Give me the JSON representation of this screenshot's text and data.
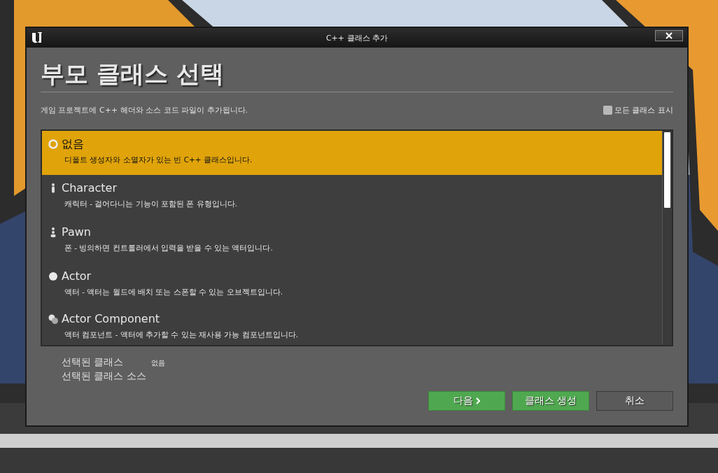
{
  "window": {
    "title": "C++ 클래스 추가"
  },
  "heading": "부모 클래스 선택",
  "description": "게임 프로젝트에 C++ 헤더와 소스 코드 파일이 추가됩니다.",
  "show_all_classes": {
    "label": "모든 클래스 표시",
    "checked": false
  },
  "classes": [
    {
      "kind": "none",
      "name": "없음",
      "description": "디폴트 생성자와 소멸자가 있는 빈 C++ 클래스입니다.",
      "selected": true
    },
    {
      "kind": "character",
      "name": "Character",
      "description": "캐릭터 - 걸어다니는 기능이 포함된 폰 유형입니다.",
      "selected": false
    },
    {
      "kind": "pawn",
      "name": "Pawn",
      "description": "폰 - 빙의하면 컨트롤러에서 입력을 받을 수 있는 액터입니다.",
      "selected": false
    },
    {
      "kind": "actor",
      "name": "Actor",
      "description": "액터 - 액터는 월드에 배치 또는 스폰할 수 있는 오브젝트입니다.",
      "selected": false
    },
    {
      "kind": "component",
      "name": "Actor Component",
      "description": "액터 컴포넌트 - 액터에 추가할 수 있는 재사용 가능 컴포넌트입니다.",
      "selected": false
    }
  ],
  "selection": {
    "class_label": "선택된 클래스",
    "class_value": "없음",
    "source_label": "선택된 클래스 소스"
  },
  "buttons": [
    {
      "label": "다음",
      "kind": "primary",
      "chevron": true
    },
    {
      "label": "클래스 생성",
      "kind": "primary",
      "chevron": false
    },
    {
      "label": "취소",
      "kind": "default",
      "chevron": false
    }
  ]
}
